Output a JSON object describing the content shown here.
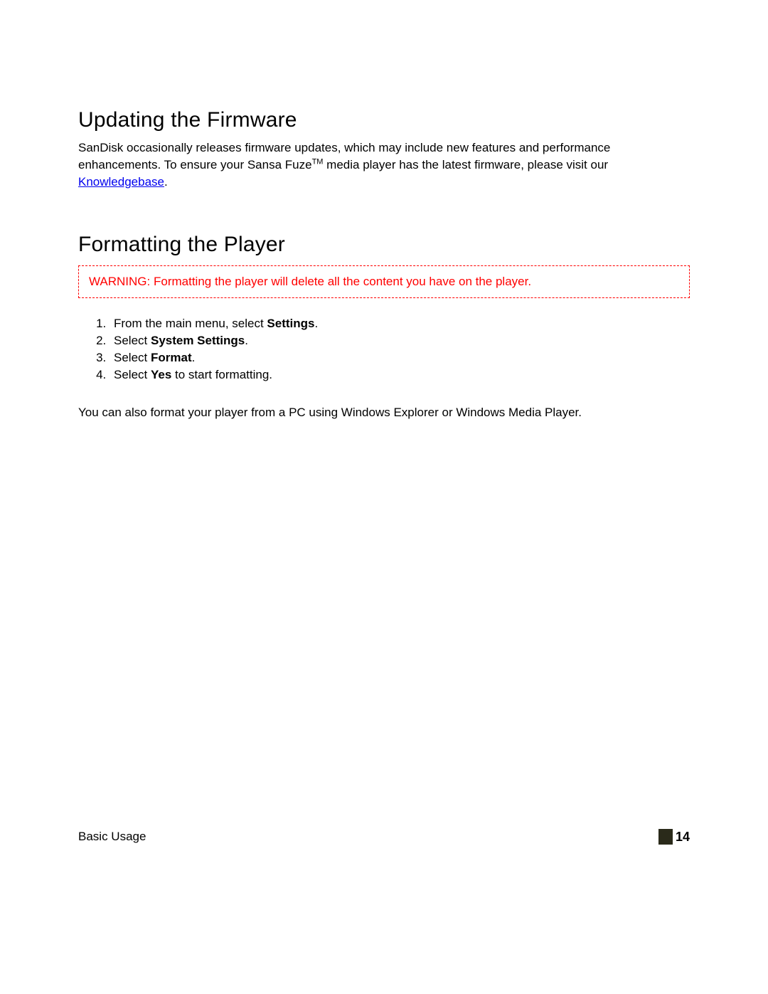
{
  "section1": {
    "heading": "Updating the Firmware",
    "para_pre": "SanDisk occasionally releases firmware updates, which may include new features and performance enhancements.  To ensure your Sansa Fuze",
    "para_tm": "TM",
    "para_mid": " media player has the latest firmware, please visit our ",
    "link_text": "Knowledgebase",
    "para_post": "."
  },
  "section2": {
    "heading": "Formatting the Player",
    "warning": "WARNING:  Formatting the player will delete all the content you have on the player.",
    "steps": [
      {
        "pre": "From the main menu, select ",
        "bold": "Settings",
        "post": "."
      },
      {
        "pre": "Select ",
        "bold": "System Settings",
        "post": "."
      },
      {
        "pre": "Select ",
        "bold": "Format",
        "post": "."
      },
      {
        "pre": "Select ",
        "bold": "Yes",
        "post": " to start formatting."
      }
    ],
    "note": "You can also format your player from a PC using Windows Explorer or Windows Media Player."
  },
  "footer": {
    "section_name": "Basic Usage",
    "page_number": "14"
  }
}
